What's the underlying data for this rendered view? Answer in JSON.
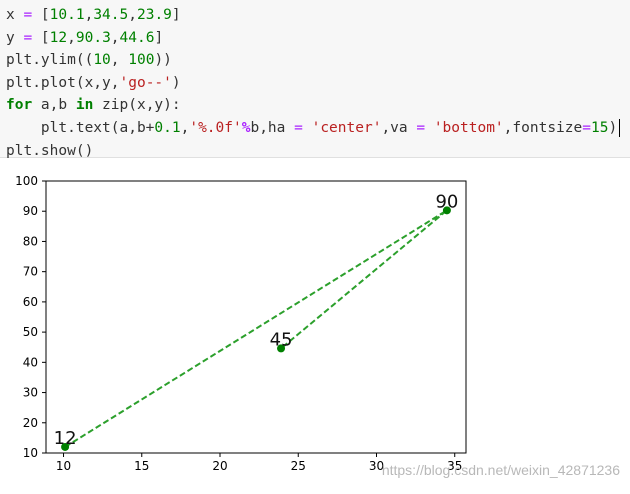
{
  "code_cell": {
    "lines": [
      "x = [10.1,34.5,23.9]",
      "y = [12,90.3,44.6]",
      "plt.ylim((10, 100))",
      "plt.plot(x,y,'go--')",
      "for a,b in zip(x,y):",
      "    plt.text(a,b+0.1,'%.0f'%b,ha = 'center',va = 'bottom',fontsize=15)",
      "plt.show()"
    ]
  },
  "chart_data": {
    "type": "line",
    "x": [
      10.1,
      34.5,
      23.9
    ],
    "y": [
      12,
      90.3,
      44.6
    ],
    "data_labels": [
      "12",
      "90",
      "45"
    ],
    "xticks": [
      "10",
      "15",
      "20",
      "25",
      "30",
      "35"
    ],
    "xtick_values": [
      10,
      15,
      20,
      25,
      30,
      35
    ],
    "yticks": [
      "10",
      "20",
      "30",
      "40",
      "50",
      "60",
      "70",
      "80",
      "90",
      "100"
    ],
    "ytick_values": [
      10,
      20,
      30,
      40,
      50,
      60,
      70,
      80,
      90,
      100
    ],
    "xlim": [
      8.88,
      35.72
    ],
    "ylim": [
      10,
      100
    ],
    "line_color": "#2ca02c",
    "marker_color": "#008000",
    "linestyle": "dashed",
    "grid": false
  },
  "watermark": "https://blog.csdn.net/weixin_42871236"
}
